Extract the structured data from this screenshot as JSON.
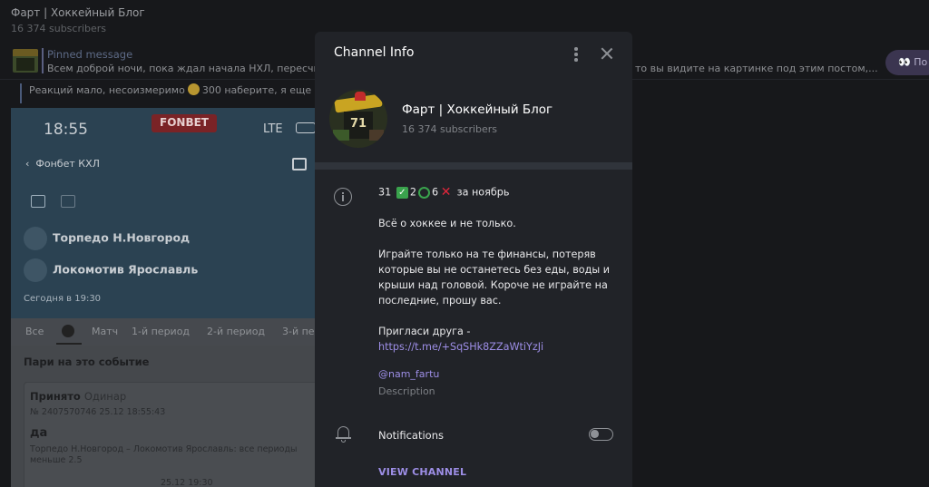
{
  "background": {
    "title": "Фарт | Хоккейный Блог",
    "subscribers": "16 374 subscribers",
    "pinned": {
      "label": "Pinned message",
      "text": "Всем доброй ночи, пока ждал начала НХЛ, пересчита",
      "text_right": "то вы видите на картинке под этим постом,...",
      "button": "👀 По"
    },
    "reply_text_a": "Реакций мало, несоизмеримо",
    "reply_text_b": "300 наберите, я еще о",
    "phone": {
      "time": "18:55",
      "brand": "FONBET",
      "network": "LTE",
      "back_label": "Фонбет КХЛ",
      "team1": "Торпедо Н.Новгород",
      "team2": "Локомотив Ярославль",
      "datetime": "Сегодня в 19:30",
      "tabs": [
        "Все",
        "Матч",
        "1-й период",
        "2-й период",
        "3-й пе"
      ],
      "section_title": "Пари на это событие",
      "card": {
        "status": "Принято",
        "type": "Одинар",
        "bet_id": "№ 2407570746   25.12   18:55:43",
        "outcome": "да",
        "details": "Торпедо Н.Новгород – Локомотив Ярославль: все периоды меньше 2.5",
        "date": "25.12 19:30"
      }
    }
  },
  "panel": {
    "title": "Channel Info",
    "channel_name": "Фарт | Хоккейный Блог",
    "subscribers": "16 374 subscribers",
    "avatar_text": "71",
    "stats": {
      "wins": "31",
      "returns": "2",
      "losses": "6",
      "suffix": "за ноябрь"
    },
    "desc_line1": "Всё о хоккее и не только.",
    "desc_para2": "Играйте только на те финансы, потеряв которые вы не останетесь без еды, воды и крыши над головой. Короче не играйте на последние, прошу вас.",
    "invite_label": "Пригласи друга -",
    "invite_link": "https://t.me/+SqSHk8ZZaWtiYzJi",
    "username": "@nam_fartu",
    "username_label": "Description",
    "notifications_label": "Notifications",
    "notifications_on": false,
    "view_button": "VIEW CHANNEL"
  },
  "icons": [
    "more-vertical-icon",
    "close-icon",
    "info-icon",
    "bell-icon",
    "check-icon",
    "recycle-icon",
    "cross-icon"
  ],
  "colors": {
    "panel_bg": "#212328",
    "accent": "#9d8ee6",
    "divider": "#30343b"
  }
}
